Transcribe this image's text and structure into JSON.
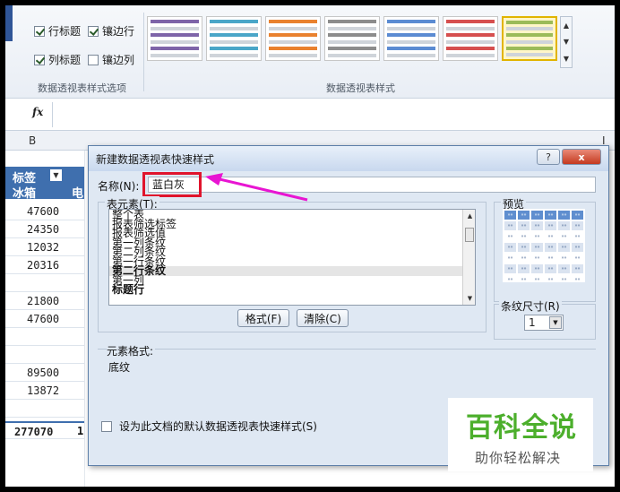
{
  "ribbon": {
    "options": [
      {
        "label": "行标题",
        "checked": true
      },
      {
        "label": "镶边行",
        "checked": true
      },
      {
        "label": "列标题",
        "checked": true
      },
      {
        "label": "镶边列",
        "checked": false
      }
    ],
    "options_group_label": "数据透视表样式选项",
    "styles_group_label": "数据透视表样式",
    "swatch_colors": [
      "#7e64a8",
      "#4aa6c8",
      "#e9812e",
      "#8c8c8c",
      "#5b8bd2",
      "#d64f4f",
      "#9bbb59"
    ]
  },
  "formula_bar": {
    "fx": "fx"
  },
  "sheet": {
    "col_b": "B",
    "col_extra": "I",
    "pivot_header_row1": "标签",
    "pivot_header_row2": "冰箱",
    "pivot_header_col2": "电",
    "values": [
      "47600",
      "24350",
      "12032",
      "20316",
      "",
      "21800",
      "47600",
      "",
      "",
      "89500",
      "13872",
      ""
    ],
    "total": "277070",
    "total_col2": "1"
  },
  "dialog": {
    "title": "新建数据透视表快速样式",
    "help_icon": "?",
    "close_icon": "x",
    "name_label": "名称(N):",
    "name_value": "蓝白灰",
    "elements_label": "表元素(T):",
    "list_items": [
      {
        "label": "整个表",
        "style": "normal"
      },
      {
        "label": "报表筛选标签",
        "style": "normal"
      },
      {
        "label": "报表筛选值",
        "style": "normal"
      },
      {
        "label": "第一列条纹",
        "style": "normal"
      },
      {
        "label": "第二列条纹",
        "style": "normal"
      },
      {
        "label": "第一行条纹",
        "style": "normal"
      },
      {
        "label": "第二行条纹",
        "style": "selected"
      },
      {
        "label": "第一列",
        "style": "normal"
      },
      {
        "label": "标题行",
        "style": "bold"
      }
    ],
    "format_button": "格式(F)",
    "clear_button": "清除(C)",
    "preview_label": "预览",
    "stripe_label": "条纹尺寸(R)",
    "stripe_value": "1",
    "element_format_label": "元素格式:",
    "element_format_value": "底纹",
    "default_checkbox_label": "设为此文档的默认数据透视表快速样式(S)"
  },
  "watermark": {
    "big": "百科全说",
    "small": "助你轻松解决"
  },
  "colors": {
    "accent": "#3f6fae",
    "highlight": "#e0142c",
    "arrow": "#e815d2",
    "brand_green": "#4caf2c"
  }
}
